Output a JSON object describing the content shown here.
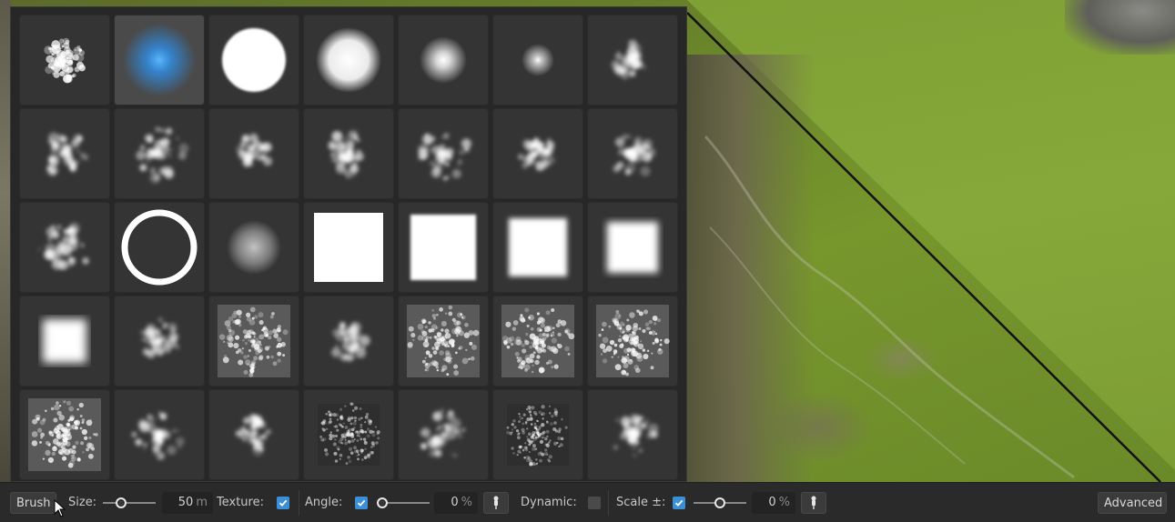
{
  "brush_panel": {
    "selected_index": 1,
    "brushes": [
      {
        "name": "brush-rock-noise"
      },
      {
        "name": "brush-soft-round-blue"
      },
      {
        "name": "brush-hard-circle"
      },
      {
        "name": "brush-soft-circle"
      },
      {
        "name": "brush-small-soft"
      },
      {
        "name": "brush-tiny-soft"
      },
      {
        "name": "brush-cloud"
      },
      {
        "name": "brush-splat-1"
      },
      {
        "name": "brush-splat-2"
      },
      {
        "name": "brush-splat-3"
      },
      {
        "name": "brush-splat-4"
      },
      {
        "name": "brush-splat-5"
      },
      {
        "name": "brush-streak"
      },
      {
        "name": "brush-splat-6"
      },
      {
        "name": "brush-faint-splat"
      },
      {
        "name": "brush-ring"
      },
      {
        "name": "brush-blur-round"
      },
      {
        "name": "brush-square-hard"
      },
      {
        "name": "brush-square-soft-1"
      },
      {
        "name": "brush-square-soft-2"
      },
      {
        "name": "brush-square-soft-3"
      },
      {
        "name": "brush-square-softest"
      },
      {
        "name": "brush-rocks"
      },
      {
        "name": "brush-erosion-1"
      },
      {
        "name": "brush-erosion-2"
      },
      {
        "name": "brush-erosion-3"
      },
      {
        "name": "brush-erosion-4"
      },
      {
        "name": "brush-erosion-5"
      },
      {
        "name": "brush-ridges"
      },
      {
        "name": "brush-rock-cluster"
      },
      {
        "name": "brush-gravel"
      },
      {
        "name": "brush-noise-square"
      },
      {
        "name": "brush-pebbles"
      },
      {
        "name": "brush-grain-square"
      },
      {
        "name": "brush-blots"
      }
    ]
  },
  "toolbar": {
    "brush_label": "Brush",
    "size_label": "Size:",
    "size_value": "50",
    "size_unit": "m",
    "size_slider_fraction": 0.3,
    "texture_label": "Texture:",
    "texture_checked": true,
    "angle_label": "Angle:",
    "angle_checked": true,
    "angle_value": "0",
    "angle_unit": "%",
    "angle_slider_fraction": 0.0,
    "dynamic_label": "Dynamic:",
    "dynamic_checked": false,
    "scale_label": "Scale ±:",
    "scale_checked": true,
    "scale_value": "0",
    "scale_unit": "%",
    "scale_slider_fraction": 0.5,
    "advanced_label": "Advanced"
  },
  "colors": {
    "accent": "#3a8fd6",
    "selected_brush_glow": "#3aa0ff"
  }
}
